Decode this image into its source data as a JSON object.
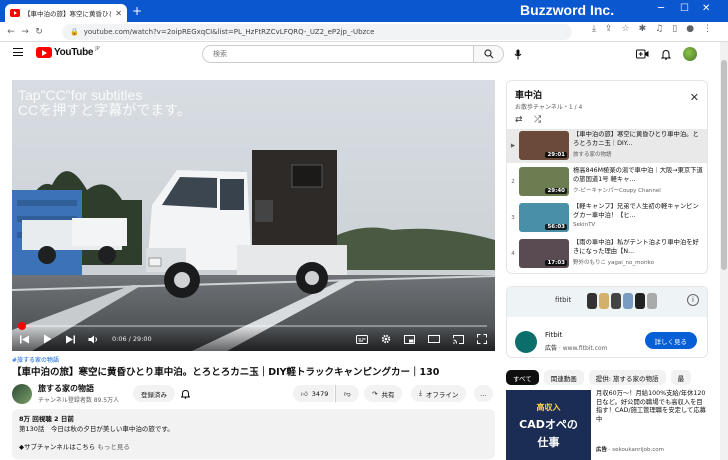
{
  "browser": {
    "tab_title": "【車中泊の旅】寒空に黄昏ひとり",
    "brand": "Buzzword Inc.",
    "url": "youtube.com/watch?v=2oipREGxqCI&list=PL_HzFtRZCvLFQRQ-_UZ2_eP2jp_-Ubzce"
  },
  "youtube": {
    "logo_text": "YouTube",
    "region": "JP",
    "search_placeholder": "検索"
  },
  "player": {
    "cc_hint_line1": "Tap\"CC\"for subtitles",
    "cc_hint_line2": "CCを押すと字幕がでます。",
    "time": "0:06 / 29:00",
    "progress_fraction": 0.0034
  },
  "video": {
    "tag": "#旅する家の物語",
    "title": "【車中泊の旅】寒空に黄昏ひとり車中泊。とろとろカニ玉｜DIY軽トラックキャンピングカー｜130",
    "channel_name": "旅する家の物語",
    "channel_subs": "チャンネル登録者数 89.5万人",
    "subscribe_label": "登録済み",
    "like_count": "3479",
    "share_label": "共有",
    "offline_label": "オフライン",
    "more_label": "…"
  },
  "description": {
    "meta": "8万 回視聴  2 日前",
    "line1": "第130話　今日は秋の夕日が美しい車中泊の旅です。",
    "line2": "◆サブチャンネルはこちら",
    "more": "もっと見る"
  },
  "playlist": {
    "title": "車中泊",
    "subtitle": "お散歩チャンネル・1 / 4",
    "items": [
      {
        "idx": "▶",
        "title": "【車中泊の旅】寒空に黄昏ひとり車中泊。とろとろカニ玉｜DIY...",
        "channel": "旅する家の物語",
        "duration": "29:01",
        "thumb": "#6b4a3a"
      },
      {
        "idx": "2",
        "title": "標高846M極楽の湯で車中泊｜大阪→東京下道の旅国道1号 軽キャ...",
        "channel": "ク-ピーキャンパーCoupy Channel",
        "duration": "29:40",
        "thumb": "#6d7d52"
      },
      {
        "idx": "3",
        "title": "【軽キャンプ】兄弟で人生初の軽キャンピングカー車中泊！【ヒ...",
        "channel": "SekinTV",
        "duration": "56:03",
        "thumb": "#4a8fa8"
      },
      {
        "idx": "4",
        "title": "【雨の車中泊】私がテント泊より車中泊を好きになった理由【N...",
        "channel": "野外のもりこ yagai_no_moriko",
        "duration": "17:03",
        "thumb": "#5a4a52"
      }
    ]
  },
  "ad": {
    "banner_brand": "fitbit",
    "name": "Fitbit",
    "label": "広告",
    "url": "www.fitbit.com",
    "cta": "詳しく見る"
  },
  "chips": [
    "すべて",
    "関連動画",
    "提供: 旅する家の物語",
    "最"
  ],
  "rec_ad": {
    "thumb_line1": "高収入",
    "thumb_line2": "CADオペの",
    "thumb_line3": "仕事",
    "title": "月収60万～！月給100%支給/年休120日など。好公開の職場でも高収入を目指す！CAD/施工管理職を安定して応募中",
    "ad_label": "広告",
    "ad_url": "sekoukanrijob.com"
  }
}
